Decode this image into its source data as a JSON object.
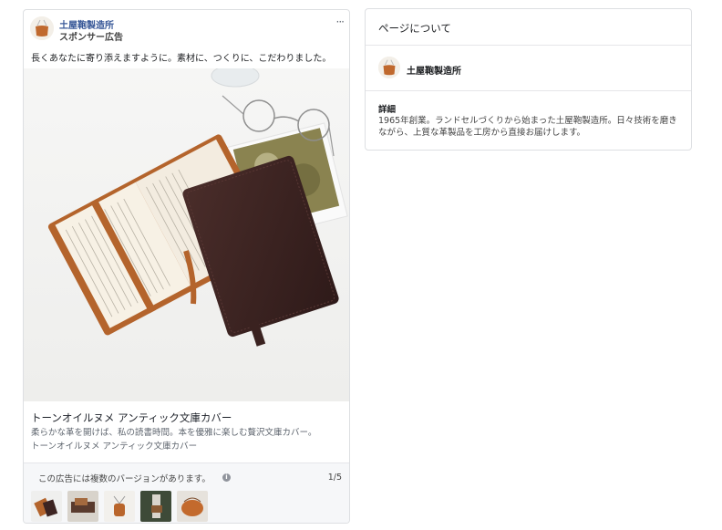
{
  "ad": {
    "page_name": "土屋鞄製造所",
    "sponsored": "スポンサー広告",
    "more_menu": "···",
    "primary_text": "長くあなたに寄り添えますように。素材に、つくりに、こだわりました。",
    "link_title": "トーンオイルヌメ アンティック文庫カバー",
    "link_description": "柔らかな革を開けば、私の読書時間。本を優雅に楽しむ贅沢文庫カバー。",
    "link_caption": "トーンオイルヌメ アンティック文庫カバー",
    "versions_text": "この広告には複数のバージョンがあります。",
    "info_icon": "i",
    "version_counter": "1/5"
  },
  "about": {
    "title": "ページについて",
    "page_name": "土屋鞄製造所",
    "details_label": "詳細",
    "details_text": "1965年創業。ランドセルづくりから始まった土屋鞄製造所。日々技術を磨きながら、上質な革製品を工房から直接お届けします。"
  },
  "colors": {
    "link_blue": "#385898",
    "selected_bar": "#4267b2",
    "leather_brown": "#3d2422",
    "leather_tan": "#b9652b"
  },
  "icons": [
    "logo-bag-icon",
    "more-options-icon",
    "info-icon"
  ]
}
